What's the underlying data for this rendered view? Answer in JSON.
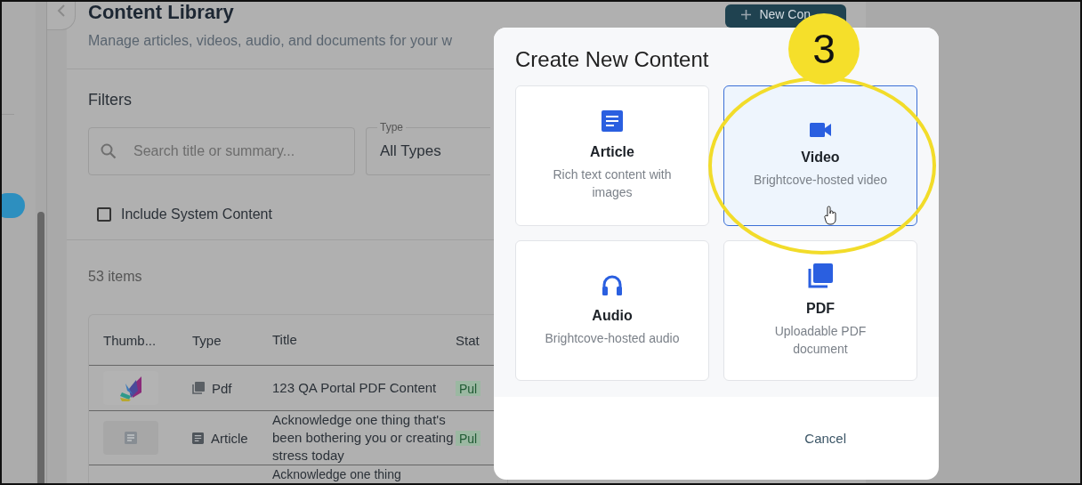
{
  "page": {
    "title": "Content Library",
    "subtitle": "Manage articles, videos, audio, and documents for your w",
    "new_button": "New Con"
  },
  "filters": {
    "heading": "Filters",
    "search": {
      "placeholder": "Search title or summary..."
    },
    "type_select": {
      "label": "Type",
      "value": "All Types"
    },
    "include_system": {
      "label": "Include System Content",
      "checked": false
    }
  },
  "count": "53 items",
  "table": {
    "columns": [
      "Thumb...",
      "Type",
      "Title",
      "Stat"
    ],
    "rows": [
      {
        "kind": "pdf",
        "type": "Pdf",
        "title": "123 QA Portal PDF Content",
        "status": "Pul"
      },
      {
        "kind": "article",
        "type": "Article",
        "title": "Acknowledge one thing that's been bothering you or creating stress today",
        "status": "Pul"
      },
      {
        "title": "Acknowledge one thing"
      }
    ]
  },
  "modal": {
    "title": "Create New Content",
    "options": [
      {
        "kind": "article",
        "name": "Article",
        "description": "Rich text content with images",
        "selected": false
      },
      {
        "kind": "video",
        "name": "Video",
        "description": "Brightcove-hosted video",
        "selected": true
      },
      {
        "kind": "audio",
        "name": "Audio",
        "description": "Brightcove-hosted audio",
        "selected": false
      },
      {
        "kind": "pdf",
        "name": "PDF",
        "description": "Uploadable PDF document",
        "selected": false
      }
    ],
    "cancel": "Cancel"
  },
  "annotation": {
    "step": "3"
  }
}
